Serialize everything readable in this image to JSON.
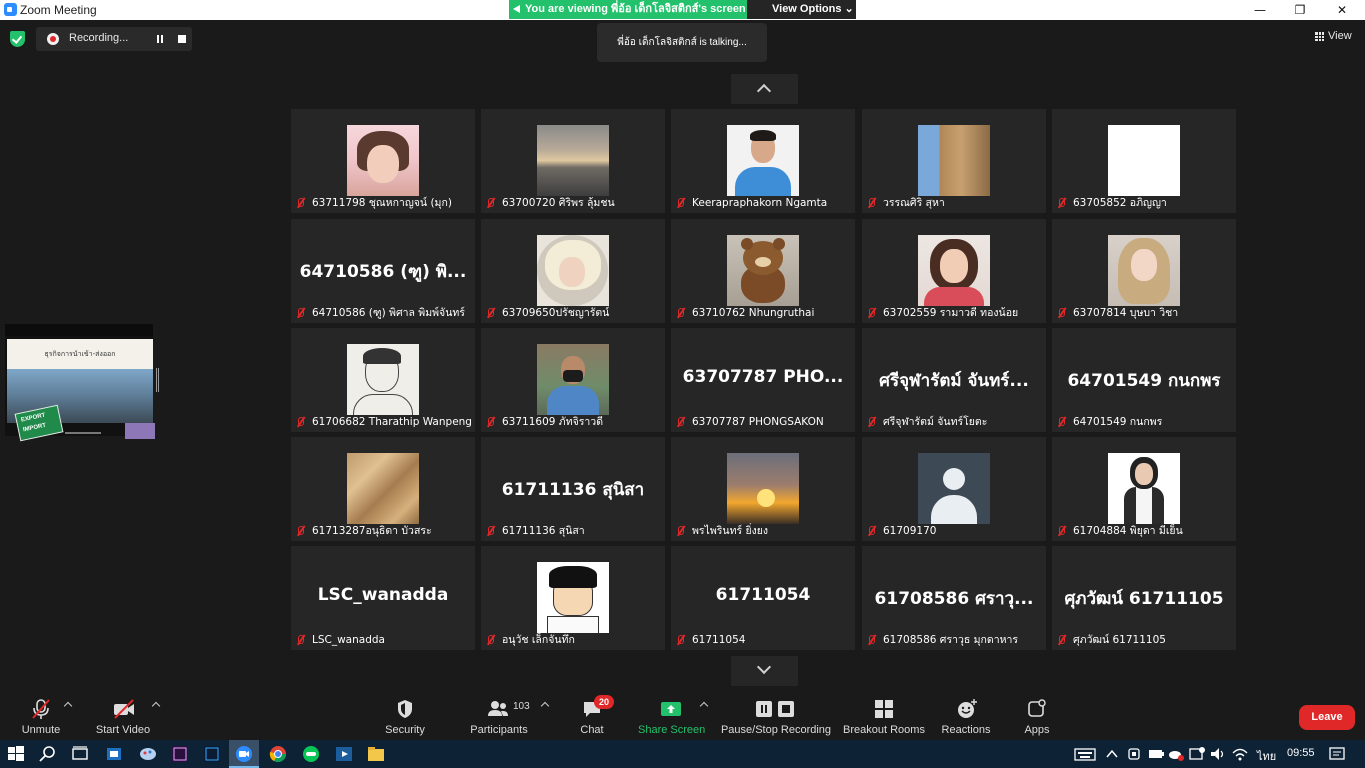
{
  "window": {
    "title": "Zoom Meeting",
    "minimize": "—",
    "maximize": "❐",
    "close": "✕"
  },
  "banner": {
    "viewing_text": "You are viewing พี่อ้อ เด็กโลจิสติกส์'s screen",
    "view_options_label": "View Options ⌄"
  },
  "recording": {
    "label": "Recording..."
  },
  "talking_indicator": "พี่อ้อ เด็กโลจิสติกส์ is  talking...",
  "view_button": "View",
  "shared_screen": {
    "slide_title": "ธุรกิจการนำเข้า-ส่งออก",
    "sign_top": "EXPORT",
    "sign_bottom": "IMPORT"
  },
  "participants": [
    {
      "name": "63711798 ชุณหกาญจน์ (มุก)",
      "video": "t-pink"
    },
    {
      "name": "63700720  ศิริพร ลุ้มชน",
      "video": "t-sea"
    },
    {
      "name": "Keerapraphakorn Ngamta",
      "video": "t-man"
    },
    {
      "name": "วรรณศิริ สุหา",
      "video": "t-building"
    },
    {
      "name": "63705852 อภิญญา",
      "video": "t-white"
    },
    {
      "name": "64710586 (ฑู) พิศาล  พิมพ์จันทร์",
      "display": "64710586 (ฑู) พิ...",
      "video": ""
    },
    {
      "name": "63709650ปรัชญารัตน์",
      "video": "t-girl-circle"
    },
    {
      "name": "63710762 Nhungruthai",
      "video": "t-bear"
    },
    {
      "name": "63702559 รามาวดี ทองน้อย",
      "video": "t-woman-red"
    },
    {
      "name": "63707814 บุษบา วิชา",
      "video": "t-blonde"
    },
    {
      "name": "61706682 Tharathip Wanpeng",
      "video": "t-sketch"
    },
    {
      "name": "63711609 ภัทจิราวดี",
      "video": "t-boy"
    },
    {
      "name": "63707787 PHONGSAKON",
      "display": "63707787  PHO...",
      "video": ""
    },
    {
      "name": "ศรีจุฬารัตม์ จันทร์โยตะ",
      "display": "ศรีจุฬารัตม์ จันทร์...",
      "video": ""
    },
    {
      "name": "64701549 กนกพร",
      "display": "64701549 กนกพร",
      "video": ""
    },
    {
      "name": "61713287อนุธิดา บัวสระ",
      "video": "t-bread"
    },
    {
      "name": "61711136 สุนิสา",
      "display": "61711136 สุนิสา",
      "video": ""
    },
    {
      "name": "พรไพรินทร์ ยิ่งยง",
      "video": "t-sunset"
    },
    {
      "name": "61709170",
      "video": "t-avatar"
    },
    {
      "name": "61704884 พิยุดา มีเย็น",
      "video": "t-student"
    },
    {
      "name": "LSC_wanadda",
      "display": "LSC_wanadda",
      "video": ""
    },
    {
      "name": "อนุวัช เล็กจันทึก",
      "video": "t-cartoon"
    },
    {
      "name": "61711054",
      "display": "61711054",
      "video": ""
    },
    {
      "name": "61708586 ศราวุธ มุกดาหาร",
      "display": "61708586 ศราวุ...",
      "video": ""
    },
    {
      "name": "ศุภวัฒน์ 61711105",
      "display": "ศุภวัฒน์ 61711105",
      "video": ""
    }
  ],
  "toolbar": {
    "unmute": "Unmute",
    "start_video": "Start Video",
    "security": "Security",
    "participants": "Participants",
    "participants_count": "103",
    "chat": "Chat",
    "chat_badge": "20",
    "share_screen": "Share Screen",
    "pause_stop_recording": "Pause/Stop Recording",
    "breakout_rooms": "Breakout Rooms",
    "reactions": "Reactions",
    "apps": "Apps",
    "leave": "Leave"
  },
  "taskbar": {
    "language": "ไทย",
    "clock": "09:55"
  },
  "colors": {
    "accent_green": "#23c16b",
    "mute_red": "#e02828",
    "leave_red": "#e02828",
    "tile_bg": "#262626",
    "app_bg": "#1a1a1a"
  }
}
